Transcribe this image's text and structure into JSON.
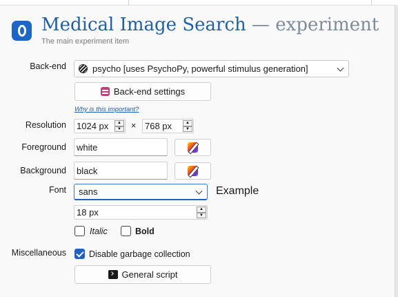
{
  "header": {
    "title": "Medical Image Search",
    "dash": "—",
    "subtitle_word": "experiment",
    "description": "The main experiment item"
  },
  "labels": {
    "backend": "Back-end",
    "resolution": "Resolution",
    "foreground": "Foreground",
    "background": "Background",
    "font": "Font",
    "misc": "Miscellaneous"
  },
  "backend": {
    "selected": "psycho [uses PsychoPy, powerful stimulus generation]",
    "settings_button": "Back-end settings",
    "why_link": "Why is this important?"
  },
  "resolution": {
    "width": "1024 px",
    "times": "×",
    "height": "768 px"
  },
  "colors": {
    "foreground": "white",
    "background": "black"
  },
  "font": {
    "family": "sans",
    "example": "Example",
    "size": "18 px",
    "italic_label": "Italic",
    "italic": false,
    "bold_label": "Bold",
    "bold": false
  },
  "misc": {
    "gc_label": "Disable garbage collection",
    "gc_checked": true,
    "script_button": "General script"
  },
  "theme": {
    "accent": "#1d61ad",
    "logo": "#1b66c8",
    "checkbox": "#1d62c4"
  },
  "icons": [
    "opensesame-logo-icon",
    "backend-icon",
    "settings-icon",
    "palette-icon",
    "chevron-down-icon",
    "terminal-icon"
  ]
}
